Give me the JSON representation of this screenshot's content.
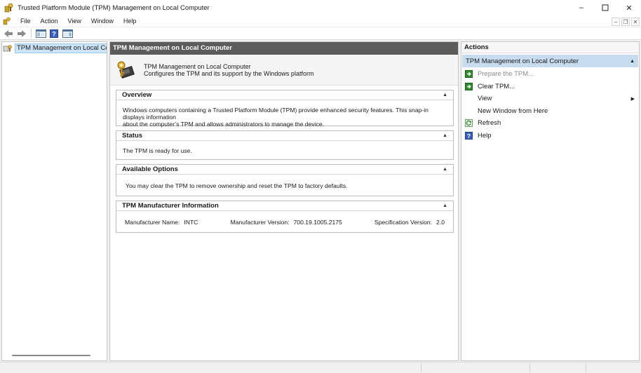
{
  "window": {
    "title": "Trusted Platform Module (TPM) Management on Local Computer",
    "minimize": "–",
    "maximize": "☐",
    "close": "✕"
  },
  "menu": {
    "items": [
      "File",
      "Action",
      "View",
      "Window",
      "Help"
    ],
    "mdi_min": "–",
    "mdi_restore": "❐",
    "mdi_close": "✕"
  },
  "toolbar": {
    "buttons": [
      "back-arrow-icon",
      "forward-arrow-icon",
      "show-hide-console-tree-icon",
      "help-icon",
      "show-hide-action-pane-icon"
    ]
  },
  "tree": {
    "item_label": "TPM Management on Local Computer"
  },
  "center": {
    "header": "TPM Management on Local Computer",
    "intro_title": "TPM Management on Local Computer",
    "intro_desc": "Configures the TPM and its support by the Windows platform",
    "overview": {
      "title": "Overview",
      "text_line1": "Windows computers containing a Trusted Platform Module (TPM) provide enhanced security features. This snap-in displays information",
      "text_line2": "about the computer’s TPM and allows administrators to manage the device."
    },
    "status": {
      "title": "Status",
      "text": "The TPM is ready for use."
    },
    "options": {
      "title": "Available Options",
      "text": "You may clear the TPM to remove ownership and reset the TPM to factory defaults."
    },
    "manufacturer": {
      "title": "TPM Manufacturer Information",
      "name_label": "Manufacturer Name:",
      "name_value": "INTC",
      "version_label": "Manufacturer Version:",
      "version_value": "700.19.1005.2175",
      "spec_label": "Specification Version:",
      "spec_value": "2.0"
    },
    "collapse_glyph": "▲"
  },
  "actions": {
    "header": "Actions",
    "group": "TPM Management on Local Computer",
    "group_glyph": "▲",
    "items": {
      "prepare": "Prepare the TPM...",
      "clear": "Clear TPM...",
      "view": "View",
      "new_window": "New Window from Here",
      "refresh": "Refresh",
      "help": "Help"
    },
    "submenu_glyph": "▶"
  },
  "colors": {
    "header_bg": "#5c5c5c",
    "selection": "#cce4f7",
    "action_group": "#c7dcef",
    "green_icon": "#2e8b2e",
    "help_icon": "#3b5fbf"
  }
}
